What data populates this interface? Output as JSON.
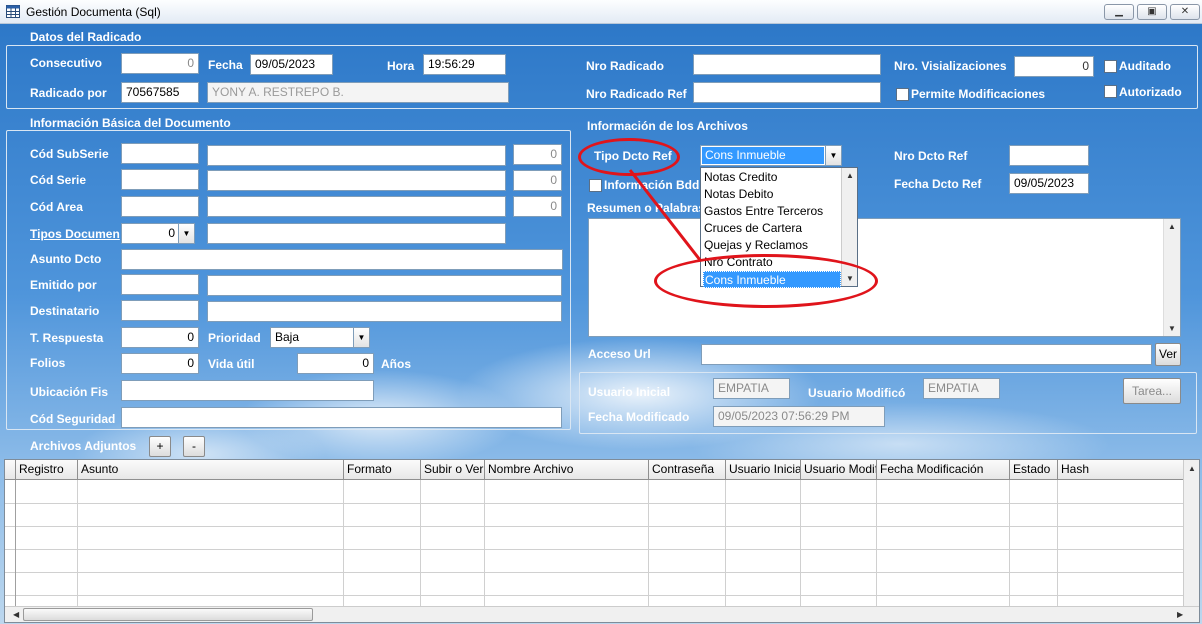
{
  "window": {
    "title": "Gestión Documenta (Sql)"
  },
  "radicado": {
    "group_title": "Datos del Radicado",
    "consecutivo_label": "Consecutivo",
    "consecutivo_value": "0",
    "fecha_label": "Fecha",
    "fecha_value": "09/05/2023",
    "hora_label": "Hora",
    "hora_value": "19:56:29",
    "radicado_por_label": "Radicado por",
    "radicado_por_id": "70567585",
    "radicado_por_name": "YONY A. RESTREPO B.",
    "nro_radicado_label": "Nro Radicado",
    "nro_radicado_ref_label": "Nro Radicado Ref",
    "nro_visualizaciones_label": "Nro. Visializaciones",
    "nro_visualizaciones_value": "0",
    "permite_modificaciones_label": "Permite Modificaciones",
    "auditado_label": "Auditado",
    "autorizado_label": "Autorizado"
  },
  "basica": {
    "group_title": "Información Básica del Documento",
    "cod_subserie_label": "Cód SubSerie",
    "cod_subserie_num": "0",
    "cod_serie_label": "Cód Serie",
    "cod_serie_num": "0",
    "cod_area_label": "Cód Area",
    "cod_area_num": "0",
    "tipos_documen_label": "Tipos Documen",
    "tipos_documen_value": "0",
    "asunto_label": "Asunto Dcto",
    "emitido_label": "Emitido por",
    "destinatario_label": "Destinatario",
    "t_respuesta_label": "T. Respuesta",
    "t_respuesta_value": "0",
    "prioridad_label": "Prioridad",
    "prioridad_value": "Baja",
    "folios_label": "Folios",
    "folios_value": "0",
    "vida_util_label": "Vida útil",
    "vida_util_value": "0",
    "anios_label": "Años",
    "ubicacion_label": "Ubicación Fis",
    "cod_seguridad_label": "Cód Seguridad"
  },
  "archivos": {
    "group_title": "Información de los Archivos",
    "tipo_dcto_ref_label": "Tipo Dcto Ref",
    "tipo_dcto_ref_value": "Cons Inmueble",
    "informacion_bdd_label": "Información Bdd",
    "resumen_label": "Resumen o Palabras",
    "nro_dcto_ref_label": "Nro Dcto Ref",
    "fecha_dcto_ref_label": "Fecha Dcto Ref",
    "fecha_dcto_ref_value": "09/05/2023",
    "acceso_url_label": "Acceso Url",
    "ver_button": "Ver",
    "dropdown_options": [
      "Notas Credito",
      "Notas Debito",
      "Gastos Entre Terceros",
      "Cruces de Cartera",
      "Quejas y Reclamos",
      "Nro Contrato",
      "Cons Inmueble"
    ]
  },
  "auditoria": {
    "usuario_inicial_label": "Usuario Inicial",
    "usuario_inicial_value": "EMPATIA",
    "usuario_modifico_label": "Usuario Modificó",
    "usuario_modifico_value": "EMPATIA",
    "fecha_modificado_label": "Fecha Modificado",
    "fecha_modificado_value": "09/05/2023 07:56:29 PM",
    "tarea_button": "Tarea..."
  },
  "adjuntos": {
    "title": "Archivos Adjuntos",
    "add_button": "+",
    "remove_button": "-",
    "columns": [
      "Registro",
      "Asunto",
      "Formato",
      "Subir o Ver",
      "Nombre Archivo",
      "Contraseña",
      "Usuario Inicial",
      "Usuario Modif",
      "Fecha Modificación",
      "Estado",
      "Hash"
    ]
  },
  "colors": {
    "annotation": "#e0141b",
    "selection": "#3399ff",
    "label_text": "#ffffff"
  }
}
